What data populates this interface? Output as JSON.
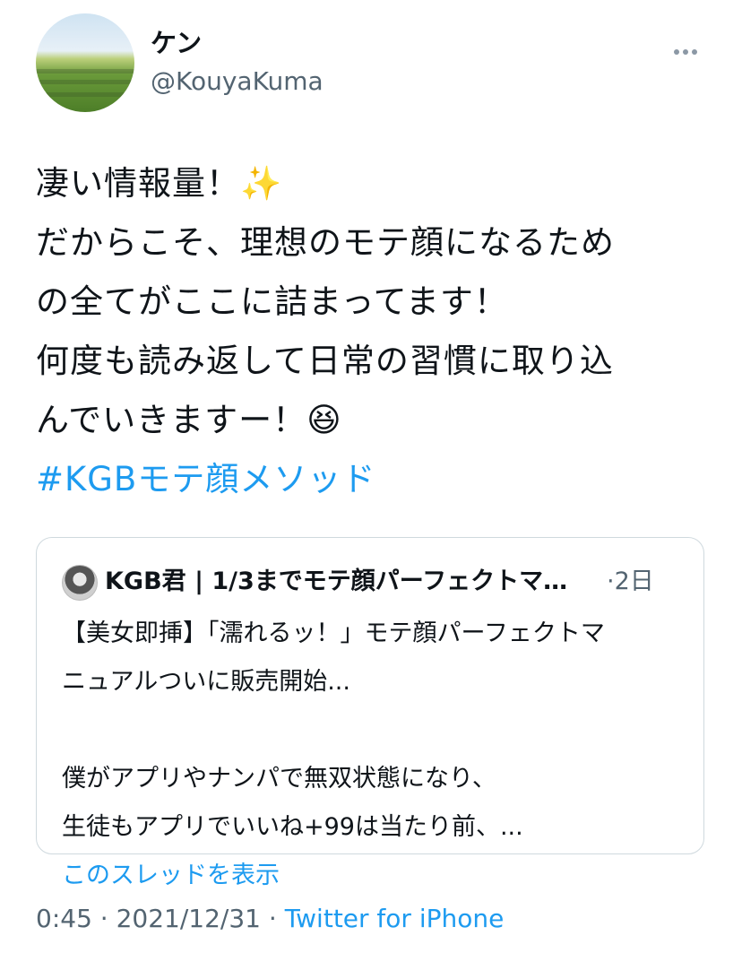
{
  "author": {
    "name": "ケン",
    "handle": "@KouyaKuma"
  },
  "tweet": {
    "lines": [
      "凄い情報量！✨",
      "だからこそ、理想のモテ顔になるため",
      "の全てがここに詰まってます！",
      "何度も読み返して日常の習慣に取り込",
      "んでいきますー！😆"
    ],
    "hashtag": "#KGBモテ顔メソッド"
  },
  "quoted": {
    "name": "KGB君 | 1/3までモテ顔パーフェクトマ…",
    "time": "·2日",
    "lines": [
      "【美女即挿】「濡れるッ！」モテ顔パーフェクトマ",
      "ニュアルついに販売開始...",
      "",
      "僕がアプリやナンパで無双状態になり、",
      "生徒もアプリでいいね+99は当たり前、..."
    ],
    "thread_link": "このスレッドを表示"
  },
  "meta": {
    "time": "0:45",
    "date": "2021/12/31",
    "separator": " · ",
    "source": "Twitter for iPhone"
  },
  "icons": {
    "more": "more-horizontal-icon"
  }
}
